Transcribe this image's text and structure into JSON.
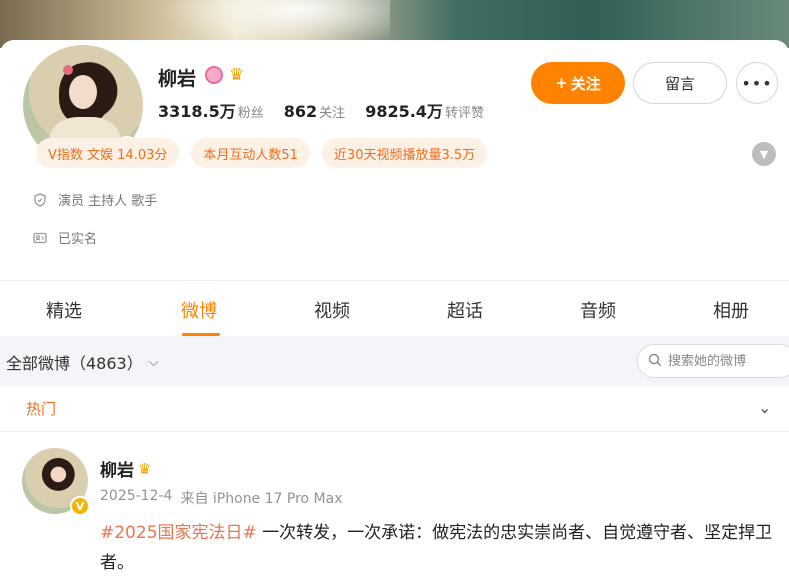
{
  "profile": {
    "name": "柳岩",
    "stats": [
      {
        "value": "3318.5万",
        "label": "粉丝"
      },
      {
        "value": "862",
        "label": "关注"
      },
      {
        "value": "9825.4万",
        "label": "转评赞"
      }
    ],
    "follow_label": "关注",
    "follow_plus": "+",
    "message_label": "留言",
    "more_icon": "more-dots-icon",
    "chips": [
      "V指数 文娱 14.03分",
      "本月互动人数51",
      "近30天视频播放量3.5万"
    ],
    "occupation": "演员 主持人 歌手",
    "verified_text": "已实名",
    "verified_badge": "V",
    "colors": {
      "accent": "#ff8200",
      "chip_text": "#f06e1e",
      "chip_bg": "#fdf1e6",
      "tag": "#eb7350"
    }
  },
  "tabs": [
    "精选",
    "微博",
    "视频",
    "超话",
    "音频",
    "相册"
  ],
  "active_tab": "微博",
  "filter": {
    "label": "全部微博（4863）",
    "search_placeholder": "搜索她的微博"
  },
  "hot": {
    "label": "热门"
  },
  "post": {
    "author": "柳岩",
    "date": "2025-12-4",
    "source": "来自 iPhone 17 Pro Max",
    "hashtag": "#2025国家宪法日#",
    "text": " 一次转发，一次承诺：做宪法的忠实崇尚者、自觉遵守者、坚定捍卫者。"
  }
}
